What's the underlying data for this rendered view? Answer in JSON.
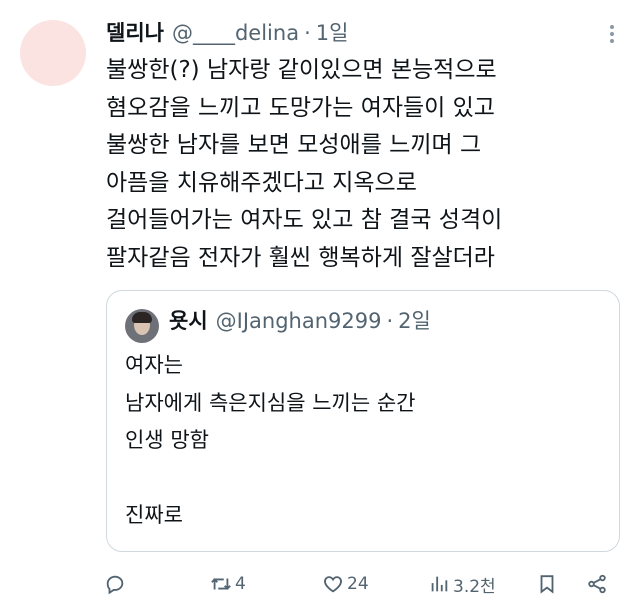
{
  "tweet": {
    "author": {
      "display_name": "델리나",
      "handle": "@____delina",
      "separator": "·",
      "time": "1일"
    },
    "lines": [
      "불쌍한(?) 남자랑 같이있으면 본능적으로",
      "혐오감을 느끼고 도망가는 여자들이 있고",
      "불쌍한 남자를 보면 모성애를 느끼며 그",
      "아픔을 치유해주겠다고 지옥으로",
      "걸어들어가는 여자도 있고 참 결국 성격이",
      "팔자같음 전자가 훨씬 행복하게 잘살더라"
    ]
  },
  "quote": {
    "author": {
      "display_name": "욧시",
      "handle": "@IJanghan9299",
      "separator": "·",
      "time": "2일"
    },
    "lines": [
      "여자는",
      "남자에게 측은지심을 느끼는 순간",
      "인생 망함",
      "",
      "진짜로"
    ]
  },
  "actions": {
    "reply_icon": "reply-icon",
    "retweet_icon": "retweet-icon",
    "retweet_count": "4",
    "like_icon": "heart-icon",
    "like_count": "24",
    "views_icon": "views-icon",
    "views_count": "3.2천",
    "bookmark_icon": "bookmark-icon",
    "share_icon": "share-icon"
  },
  "colors": {
    "text": "#0f1419",
    "secondary": "#536471",
    "border": "#cfd9de",
    "avatar_bg": "#fbe3e1"
  }
}
